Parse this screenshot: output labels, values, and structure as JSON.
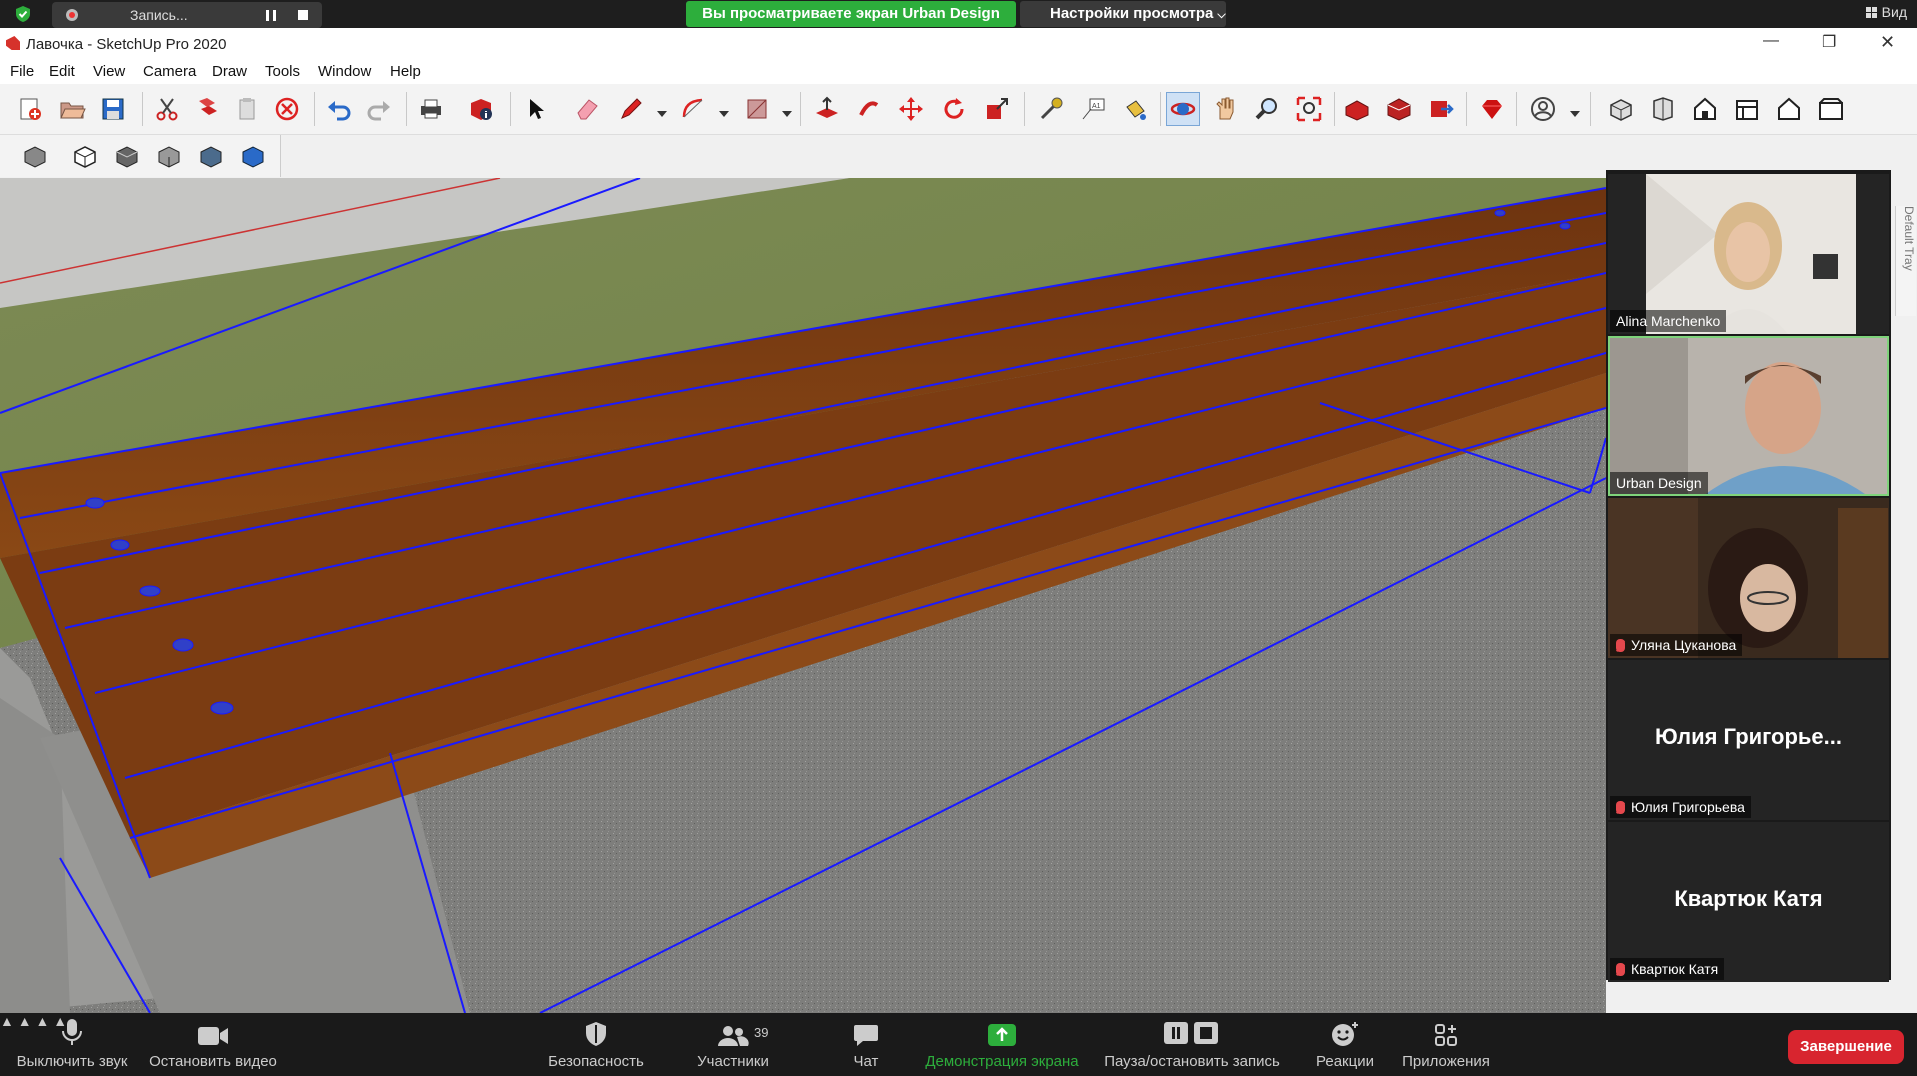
{
  "zoom_top": {
    "recording_label": "Запись...",
    "share_banner": "Вы просматриваете экран Urban Design",
    "view_settings": "Настройки просмотра",
    "view_button": "Вид"
  },
  "sketchup": {
    "title": "Лавочка - SketchUp Pro 2020",
    "menu": [
      "File",
      "Edit",
      "View",
      "Camera",
      "Draw",
      "Tools",
      "Window",
      "Help"
    ],
    "default_tray_label": "Default Tray"
  },
  "gallery": {
    "tiles": [
      {
        "name": "Alina Marchenko",
        "muted": false
      },
      {
        "name": "Urban Design",
        "muted": false,
        "active_speaker": true
      },
      {
        "name": "Уляна Цуканова",
        "muted": true
      },
      {
        "name": "Юлия Григорьева",
        "display_name": "Юлия Григорье...",
        "muted": true
      },
      {
        "name": "Квартюк Катя",
        "display_name": "Квартюк Катя",
        "muted": true
      }
    ]
  },
  "zoom_bottom": {
    "mute_label": "Выключить звук",
    "video_label": "Остановить видео",
    "security_label": "Безопасность",
    "participants_label": "Участники",
    "participants_count": "39",
    "chat_label": "Чат",
    "share_label": "Демонстрация экрана",
    "record_label": "Пауза/остановить запись",
    "reactions_label": "Реакции",
    "apps_label": "Приложения",
    "end_label": "Завершение"
  },
  "colors": {
    "share_green": "#2dae3c",
    "end_red": "#d8252f",
    "edge_blue": "#1a1aff",
    "wood": "#7a3a12"
  }
}
